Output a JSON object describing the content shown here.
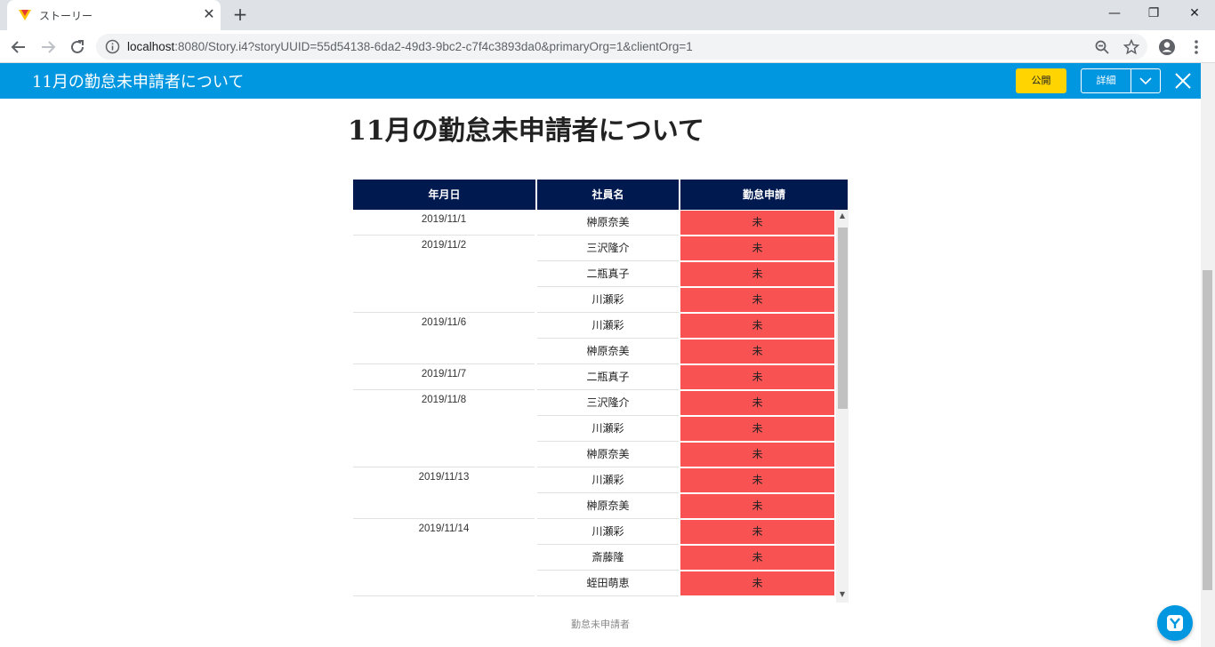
{
  "browser": {
    "tab_title": "ストーリー",
    "url_host": "localhost",
    "url_rest": ":8080/Story.i4?storyUUID=55d54138-6da2-49d3-9bc2-c7f4c3893da0&primaryOrg=1&clientOrg=1"
  },
  "header": {
    "title": "11月の勤怠未申請者について",
    "publish_label": "公開",
    "detail_label": "詳細"
  },
  "story": {
    "title": "11月の勤怠未申請者について",
    "caption": "勤怠未申請者"
  },
  "table": {
    "columns": [
      "年月日",
      "社員名",
      "勤怠申請"
    ],
    "groups": [
      {
        "date": "2019/11/1",
        "rows": [
          {
            "name": "榊原奈美",
            "status": "未"
          }
        ]
      },
      {
        "date": "2019/11/2",
        "rows": [
          {
            "name": "三沢隆介",
            "status": "未"
          },
          {
            "name": "二瓶真子",
            "status": "未"
          },
          {
            "name": "川瀬彩",
            "status": "未"
          }
        ]
      },
      {
        "date": "2019/11/6",
        "rows": [
          {
            "name": "川瀬彩",
            "status": "未"
          },
          {
            "name": "榊原奈美",
            "status": "未"
          }
        ]
      },
      {
        "date": "2019/11/7",
        "rows": [
          {
            "name": "二瓶真子",
            "status": "未"
          }
        ]
      },
      {
        "date": "2019/11/8",
        "rows": [
          {
            "name": "三沢隆介",
            "status": "未"
          },
          {
            "name": "川瀬彩",
            "status": "未"
          },
          {
            "name": "榊原奈美",
            "status": "未"
          }
        ]
      },
      {
        "date": "2019/11/13",
        "rows": [
          {
            "name": "川瀬彩",
            "status": "未"
          },
          {
            "name": "榊原奈美",
            "status": "未"
          }
        ]
      },
      {
        "date": "2019/11/14",
        "rows": [
          {
            "name": "川瀬彩",
            "status": "未"
          },
          {
            "name": "斎藤隆",
            "status": "未"
          },
          {
            "name": "蛭田萌恵",
            "status": "未"
          }
        ]
      }
    ]
  },
  "colors": {
    "header_blue": "#0096e0",
    "table_header": "#001a50",
    "status_red": "#f95253",
    "publish_yellow": "#ffd400"
  }
}
